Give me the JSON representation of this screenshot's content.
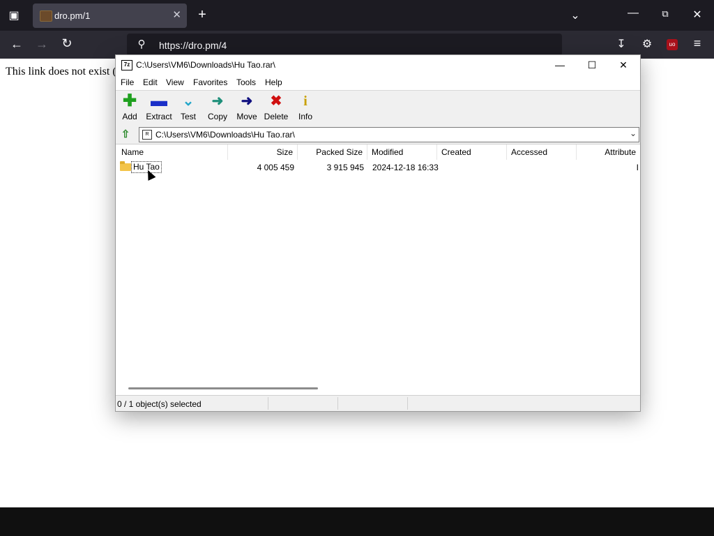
{
  "browser": {
    "tab_title": "dro.pm/1",
    "url": "https://dro.pm/4",
    "icons": [
      "tabs-list-icon",
      "new-tab-icon",
      "tab-dropdown-icon",
      "minimize-icon",
      "restore-icon",
      "close-icon",
      "back-icon",
      "forward-icon",
      "reload-icon",
      "search-icon",
      "downloads-icon",
      "extensions-icon",
      "ublock-icon",
      "menu-icon"
    ]
  },
  "page": {
    "text": "This link does not exist ("
  },
  "sevenzip": {
    "title": "C:\\Users\\VM6\\Downloads\\Hu Tao.rar\\",
    "app_icon_text": "7z",
    "menu": [
      "File",
      "Edit",
      "View",
      "Favorites",
      "Tools",
      "Help"
    ],
    "toolbar": [
      {
        "label": "Add",
        "icon": "add-icon",
        "color": "#1fa01f"
      },
      {
        "label": "Extract",
        "icon": "extract-icon",
        "color": "#1a2fc8"
      },
      {
        "label": "Test",
        "icon": "test-icon",
        "color": "#22a6c9"
      },
      {
        "label": "Copy",
        "icon": "copy-icon",
        "color": "#1e8f7a"
      },
      {
        "label": "Move",
        "icon": "move-icon",
        "color": "#101080"
      },
      {
        "label": "Delete",
        "icon": "delete-icon",
        "color": "#d01010"
      },
      {
        "label": "Info",
        "icon": "info-icon",
        "color": "#c8a000"
      }
    ],
    "address": "C:\\Users\\VM6\\Downloads\\Hu Tao.rar\\",
    "columns": [
      "Name",
      "Size",
      "Packed Size",
      "Modified",
      "Created",
      "Accessed",
      "Attribute"
    ],
    "rows": [
      {
        "name": "Hu Tao",
        "size": "4 005 459",
        "packed": "3 915 945",
        "modified": "2024-12-18 16:33",
        "created": "",
        "accessed": "",
        "attr": "I"
      }
    ],
    "status": "0 / 1 object(s) selected"
  }
}
